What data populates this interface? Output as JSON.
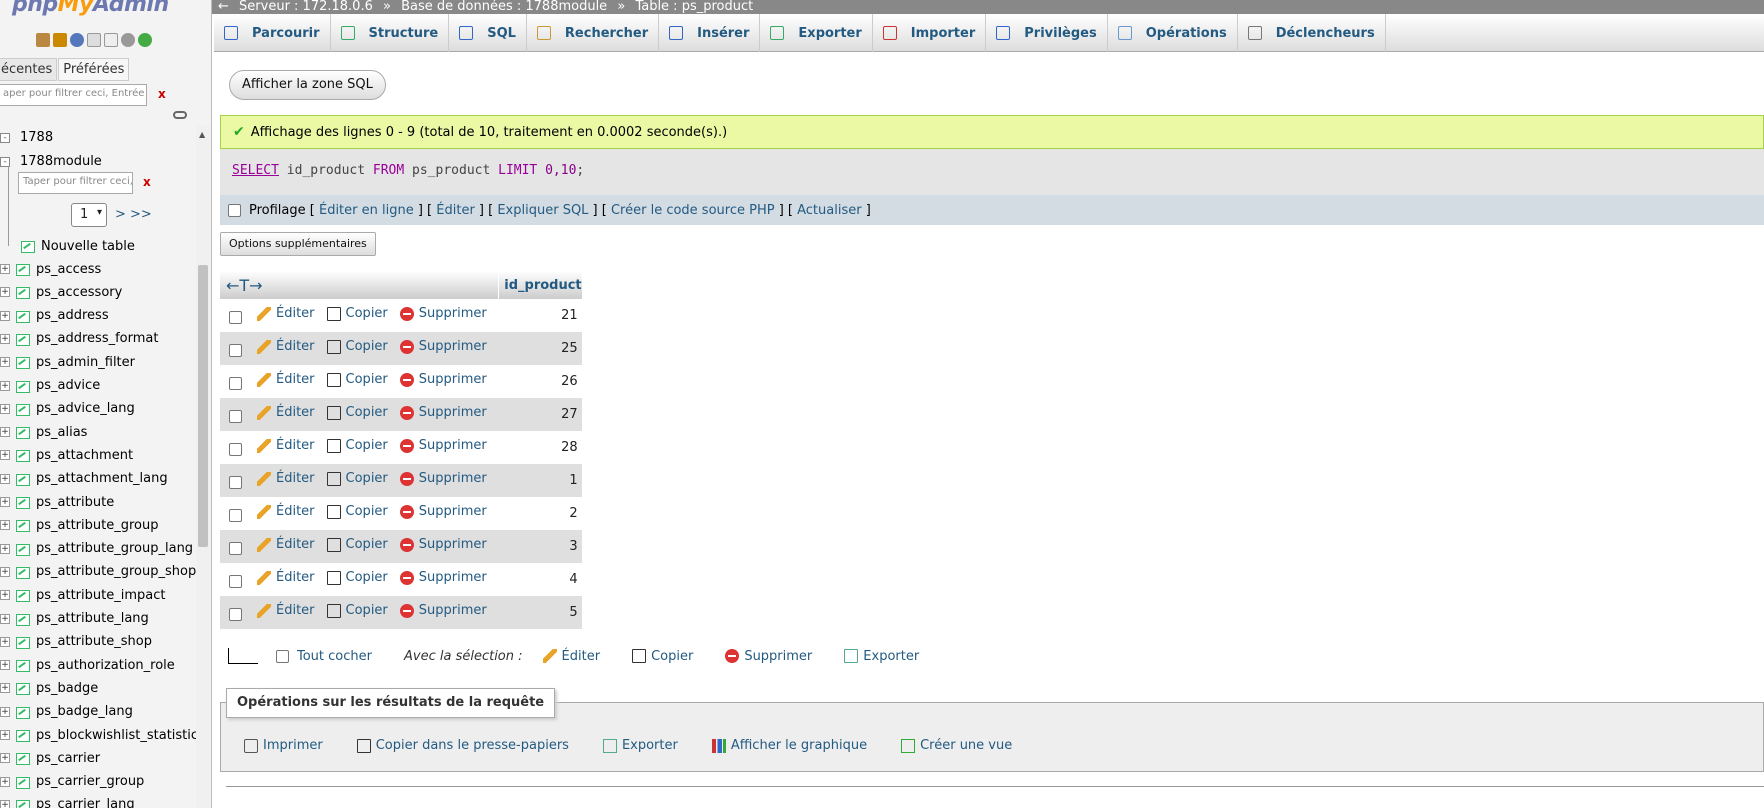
{
  "nav": {
    "logo_php": "php",
    "logo_my": "My",
    "logo_admin": "Admin",
    "tabs": [
      "écentes",
      "Préférées"
    ],
    "filter_placeholder": "aper pour filtrer ceci, Entrée pour to",
    "filter_clear": "x",
    "databases": [
      {
        "name": "1788",
        "expander": "-"
      },
      {
        "name": "1788module",
        "expander": "-"
      }
    ],
    "sub_filter_placeholder": "Taper pour filtrer ceci, Ent",
    "sub_filter_clear": "x",
    "page_select": "1",
    "page_next": "> >>",
    "new_table": "Nouvelle table",
    "tables": [
      "ps_access",
      "ps_accessory",
      "ps_address",
      "ps_address_format",
      "ps_admin_filter",
      "ps_advice",
      "ps_advice_lang",
      "ps_alias",
      "ps_attachment",
      "ps_attachment_lang",
      "ps_attribute",
      "ps_attribute_group",
      "ps_attribute_group_lang",
      "ps_attribute_group_shop",
      "ps_attribute_impact",
      "ps_attribute_lang",
      "ps_attribute_shop",
      "ps_authorization_role",
      "ps_badge",
      "ps_badge_lang",
      "ps_blockwishlist_statistics",
      "ps_carrier",
      "ps_carrier_group",
      "ps_carrier_lang"
    ]
  },
  "breadcrumb": {
    "server": "Serveur : 172.18.0.6",
    "sep": "»",
    "database": "Base de données : 1788module",
    "table": "Table : ps_product"
  },
  "tabs": [
    {
      "label": "Parcourir",
      "icon": "browse-icon"
    },
    {
      "label": "Structure",
      "icon": "structure-icon"
    },
    {
      "label": "SQL",
      "icon": "sql-icon"
    },
    {
      "label": "Rechercher",
      "icon": "search-icon"
    },
    {
      "label": "Insérer",
      "icon": "insert-icon"
    },
    {
      "label": "Exporter",
      "icon": "export-icon"
    },
    {
      "label": "Importer",
      "icon": "import-icon"
    },
    {
      "label": "Privilèges",
      "icon": "privileges-icon"
    },
    {
      "label": "Opérations",
      "icon": "operations-icon"
    },
    {
      "label": "Déclencheurs",
      "icon": "triggers-icon"
    }
  ],
  "show_sql_button": "Afficher la zone SQL",
  "success_message": "Affichage des lignes 0 - 9 (total de 10, traitement en 0.0002 seconde(s).)",
  "sql": {
    "select": "SELECT",
    "col": " id_product ",
    "from": "FROM",
    "table": " ps_product ",
    "limit": "LIMIT",
    "range": " 0,10",
    "end": ";"
  },
  "profiling": {
    "label": "Profilage",
    "links": [
      "Éditer en ligne",
      "Éditer",
      "Expliquer SQL",
      "Créer le code source PHP",
      "Actualiser"
    ]
  },
  "extra_options_button": "Options supplémentaires",
  "results": {
    "arrows": "←T→",
    "column": "id_product",
    "actions": {
      "edit": "Éditer",
      "copy": "Copier",
      "delete": "Supprimer"
    },
    "rows": [
      21,
      25,
      26,
      27,
      28,
      1,
      2,
      3,
      4,
      5
    ]
  },
  "bulk": {
    "check_all": "Tout cocher",
    "with_selection": "Avec la sélection :",
    "edit": "Éditer",
    "copy": "Copier",
    "delete": "Supprimer",
    "export": "Exporter"
  },
  "query_ops": {
    "legend": "Opérations sur les résultats de la requête",
    "items": [
      "Imprimer",
      "Copier dans le presse-papiers",
      "Exporter",
      "Afficher le graphique",
      "Créer une vue"
    ]
  }
}
